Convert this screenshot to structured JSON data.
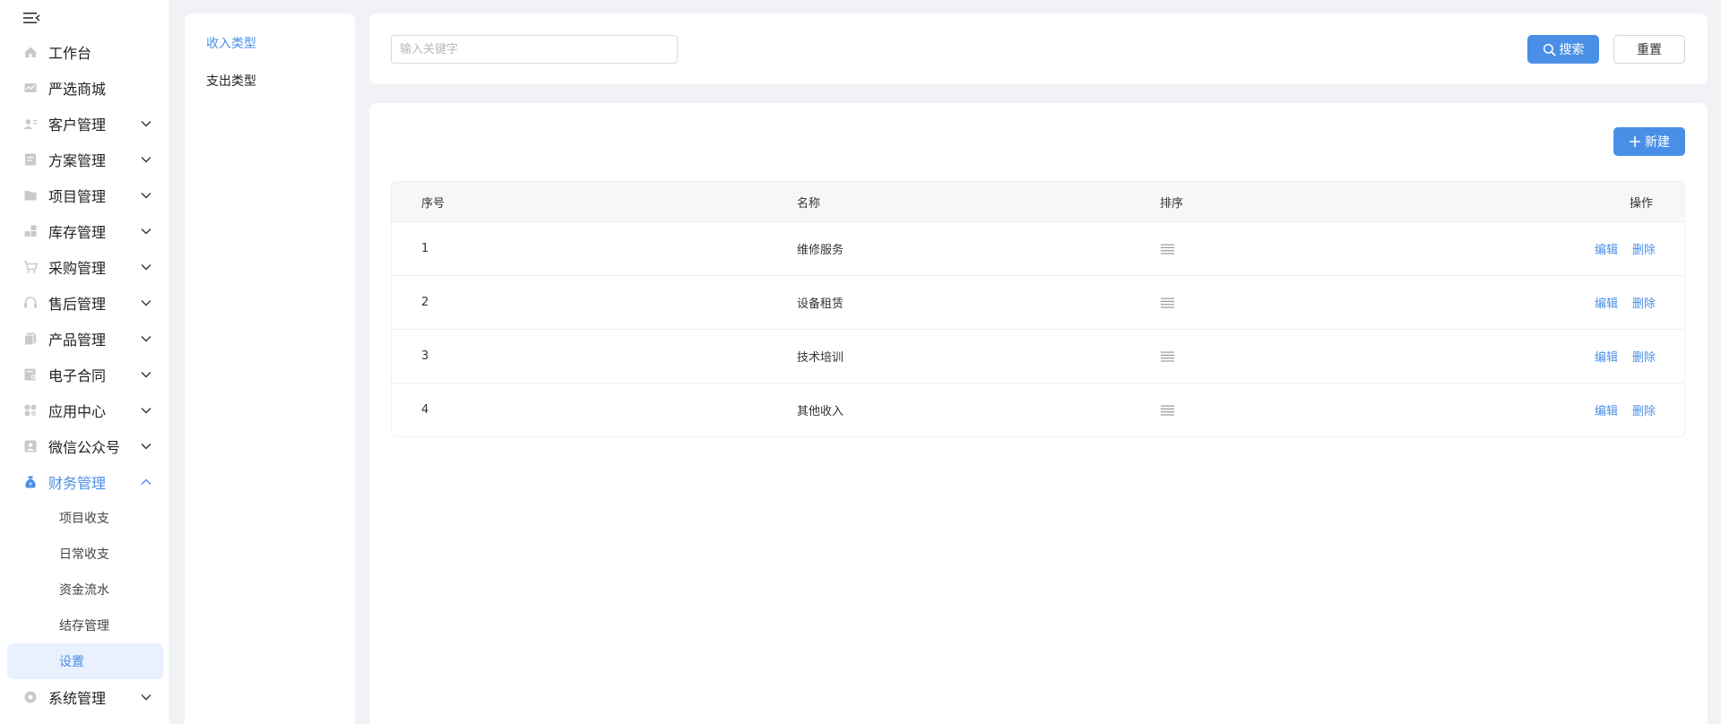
{
  "sidebar": {
    "items": [
      {
        "label": "工作台",
        "has_arrow": false
      },
      {
        "label": "严选商城",
        "has_arrow": false
      },
      {
        "label": "客户管理",
        "has_arrow": true
      },
      {
        "label": "方案管理",
        "has_arrow": true
      },
      {
        "label": "项目管理",
        "has_arrow": true
      },
      {
        "label": "库存管理",
        "has_arrow": true
      },
      {
        "label": "采购管理",
        "has_arrow": true
      },
      {
        "label": "售后管理",
        "has_arrow": true
      },
      {
        "label": "产品管理",
        "has_arrow": true
      },
      {
        "label": "电子合同",
        "has_arrow": true
      },
      {
        "label": "应用中心",
        "has_arrow": true
      },
      {
        "label": "微信公众号",
        "has_arrow": true
      },
      {
        "label": "财务管理",
        "has_arrow": true,
        "expanded": true
      },
      {
        "label": "系统管理",
        "has_arrow": true
      }
    ],
    "finance_sub": [
      "项目收支",
      "日常收支",
      "资金流水",
      "结存管理",
      "设置"
    ],
    "active_sub": "设置"
  },
  "type_panel": {
    "items": [
      "收入类型",
      "支出类型"
    ],
    "active": "收入类型"
  },
  "search": {
    "placeholder": "输入关键字",
    "value": "",
    "search_label": "搜索",
    "reset_label": "重置"
  },
  "toolbar": {
    "new_label": "新建"
  },
  "table": {
    "headers": [
      "序号",
      "名称",
      "排序",
      "操作"
    ],
    "rows": [
      {
        "index": "1",
        "name": "维修服务"
      },
      {
        "index": "2",
        "name": "设备租赁"
      },
      {
        "index": "3",
        "name": "技术培训"
      },
      {
        "index": "4",
        "name": "其他收入"
      }
    ],
    "edit_label": "编辑",
    "delete_label": "删除"
  },
  "colors": {
    "accent": "#4a8fe7",
    "active_bg": "#e8f1fd",
    "page_bg": "#f0f2f5"
  }
}
